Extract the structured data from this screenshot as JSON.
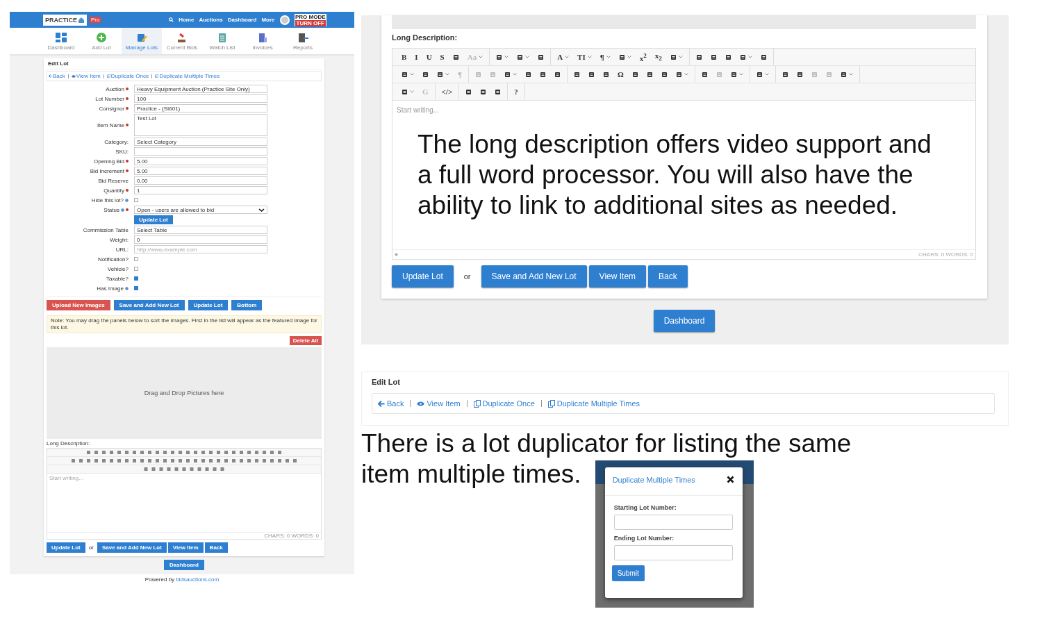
{
  "left_screen": {
    "header": {
      "logo": "PRACTICE",
      "badge": "Pro",
      "nav": [
        "Home",
        "Auctions",
        "Dashboard",
        "More"
      ],
      "pro_mode": {
        "title": "PRO MODE",
        "button": "TURN OFF"
      }
    },
    "toolbar": [
      {
        "label": "Dashboard",
        "selected": false
      },
      {
        "label": "Add Lot",
        "selected": false
      },
      {
        "label": "Manage Lots",
        "selected": true
      },
      {
        "label": "Current Bids",
        "selected": false
      },
      {
        "label": "Watch List",
        "selected": false
      },
      {
        "label": "Invoices",
        "selected": false
      },
      {
        "label": "Reports",
        "selected": false
      }
    ],
    "card_title": "Edit Lot",
    "links": [
      {
        "kind": "back",
        "label": "Back"
      },
      {
        "kind": "view",
        "label": "View Item"
      },
      {
        "kind": "copy",
        "label": "Duplicate Once"
      },
      {
        "kind": "copy",
        "label": "Duplicate Multiple Times"
      }
    ],
    "fields": [
      {
        "kind": "input",
        "label": "Auction",
        "required": true,
        "value": "Heavy Equipment Auction (Practice Site Only)"
      },
      {
        "kind": "input",
        "label": "Lot Number",
        "required": true,
        "value": "100"
      },
      {
        "kind": "select",
        "label": "Consignor",
        "required": true,
        "value": "Practice - (SI601)"
      },
      {
        "kind": "textarea",
        "label": "Item Name",
        "required": true,
        "value": "Test Lot"
      },
      {
        "kind": "select",
        "label": "Category:",
        "value": "Select Category"
      },
      {
        "kind": "input",
        "label": "SKU:"
      },
      {
        "kind": "input",
        "label": "Opening Bid",
        "required": true,
        "value": "5.00"
      },
      {
        "kind": "input",
        "label": "Bid Increment",
        "required": true,
        "value": "5.00"
      },
      {
        "kind": "input",
        "label": "Bid Reserve",
        "value": "0.00"
      },
      {
        "kind": "input",
        "label": "Quantity",
        "required": true,
        "value": "1"
      },
      {
        "kind": "checkbox",
        "label": "Hide this lot?",
        "info": true,
        "checked": false
      },
      {
        "kind": "status",
        "label": "Status",
        "info": true,
        "required": true,
        "value": "Open - users are allowed to bid"
      },
      {
        "kind": "button",
        "label": "Update Lot"
      },
      {
        "kind": "select",
        "label": "Commission Table",
        "value": "Select Table"
      },
      {
        "kind": "input",
        "label": "Weight:",
        "value": "0"
      },
      {
        "kind": "input",
        "label": "URL:",
        "placeholder": "http://www.example.com"
      },
      {
        "kind": "checkbox",
        "label": "Notification?",
        "checked": false
      },
      {
        "kind": "checkbox",
        "label": "Vehicle?",
        "checked": false
      },
      {
        "kind": "checkbox",
        "label": "Taxable?",
        "checked": true
      },
      {
        "kind": "checkbox",
        "label": "Has Image",
        "info": true,
        "checked": true
      }
    ],
    "actions": [
      {
        "kind": "danger",
        "label": "Upload New Images"
      },
      {
        "kind": "primary",
        "label": "Save and Add New Lot"
      },
      {
        "kind": "primary",
        "label": "Update Lot"
      },
      {
        "kind": "primary",
        "label": "Bottom"
      }
    ],
    "note": "Note: You may drag the panels below to sort the images. First in the list will appear as the featured image for this lot.",
    "delete_all": "Delete All",
    "dropzone": "Drag and Drop Pictures here",
    "long_description": {
      "label": "Long Description:",
      "placeholder": "Start writing...",
      "counts": "CHARS: 0  WORDS: 0"
    },
    "bottom_buttons": [
      "Update Lot",
      "Save and Add New Lot",
      "View Item",
      "Back"
    ],
    "or": "or",
    "dashboard": "Dashboard",
    "powered_by": {
      "text": "Powered by",
      "link": "bidsauctions.com"
    }
  },
  "editor_panel": {
    "label": "Long Description:",
    "toolbar_rows": [
      [
        [
          {
            "kind": "text",
            "label": "B"
          },
          {
            "kind": "text",
            "label": "I"
          },
          {
            "kind": "text",
            "label": "U"
          },
          {
            "kind": "text",
            "label": "S"
          },
          {
            "kind": "icon"
          },
          {
            "kind": "text",
            "label": "Aa",
            "dropdown": true,
            "disabled": true
          }
        ],
        [
          {
            "kind": "icon",
            "dropdown": true
          },
          {
            "kind": "icon",
            "dropdown": true
          },
          {
            "kind": "icon"
          }
        ],
        [
          {
            "kind": "text",
            "label": "A",
            "dropdown": true
          },
          {
            "kind": "text",
            "label": "TI",
            "dropdown": true
          },
          {
            "kind": "text",
            "label": "¶",
            "dropdown": true
          },
          {
            "kind": "icon",
            "dropdown": true
          },
          {
            "kind": "text",
            "label": "x$^{2}$"
          },
          {
            "kind": "text",
            "label": "x$_{2}$"
          },
          {
            "kind": "icon",
            "dropdown": true
          }
        ],
        [
          {
            "kind": "icon"
          },
          {
            "kind": "icon"
          },
          {
            "kind": "icon"
          },
          {
            "kind": "icon",
            "dropdown": true
          },
          {
            "kind": "icon"
          }
        ]
      ],
      [
        [
          {
            "kind": "icon",
            "dropdown": true
          },
          {
            "kind": "icon"
          },
          {
            "kind": "icon",
            "dropdown": true
          },
          {
            "kind": "text",
            "label": "¶",
            "disabled": true
          }
        ],
        [
          {
            "kind": "icon",
            "disabled": true
          },
          {
            "kind": "icon",
            "disabled": true
          },
          {
            "kind": "icon",
            "dropdown": true
          },
          {
            "kind": "icon"
          },
          {
            "kind": "icon"
          },
          {
            "kind": "icon"
          }
        ],
        [
          {
            "kind": "icon"
          },
          {
            "kind": "icon"
          },
          {
            "kind": "icon"
          },
          {
            "kind": "text",
            "label": "Ω"
          },
          {
            "kind": "icon"
          },
          {
            "kind": "icon"
          },
          {
            "kind": "icon"
          },
          {
            "kind": "icon",
            "dropdown": true
          }
        ],
        [
          {
            "kind": "icon"
          },
          {
            "kind": "icon",
            "disabled": true
          },
          {
            "kind": "icon",
            "dropdown": true
          }
        ],
        [
          {
            "kind": "icon",
            "dropdown": true
          }
        ],
        [
          {
            "kind": "icon"
          },
          {
            "kind": "icon"
          },
          {
            "kind": "icon",
            "disabled": true
          },
          {
            "kind": "icon",
            "disabled": true
          },
          {
            "kind": "icon",
            "dropdown": true
          }
        ]
      ],
      [
        [
          {
            "kind": "icon",
            "dropdown": true
          },
          {
            "kind": "text",
            "label": "G",
            "disabled": true
          }
        ],
        [
          {
            "kind": "text",
            "label": "</>"
          }
        ],
        [
          {
            "kind": "icon"
          },
          {
            "kind": "icon"
          },
          {
            "kind": "icon"
          }
        ],
        [
          {
            "kind": "text",
            "label": "?"
          }
        ]
      ]
    ],
    "placeholder": "Start writing...",
    "overlay_text": "The long description offers video support and a full word processor. You will also have the ability to link to additional sites as needed.",
    "counts": "CHARS: 0  WORDS: 0",
    "buttons": [
      "Update Lot",
      "Save and Add New Lot",
      "View Item",
      "Back"
    ],
    "or": "or",
    "dashboard": "Dashboard"
  },
  "edit_lot_panel": {
    "title": "Edit Lot",
    "links": [
      {
        "kind": "back",
        "label": "Back"
      },
      {
        "kind": "view",
        "label": "View Item"
      },
      {
        "kind": "copy",
        "label": "Duplicate Once"
      },
      {
        "kind": "copy",
        "label": "Duplicate Multiple Times"
      }
    ]
  },
  "caption_lines": [
    "There is a lot duplicator for listing the same",
    "item multiple times."
  ],
  "modal": {
    "title": "Duplicate Multiple Times",
    "fields": [
      {
        "label": "Starting Lot Number:"
      },
      {
        "label": "Ending Lot Number:"
      }
    ],
    "submit": "Submit"
  }
}
